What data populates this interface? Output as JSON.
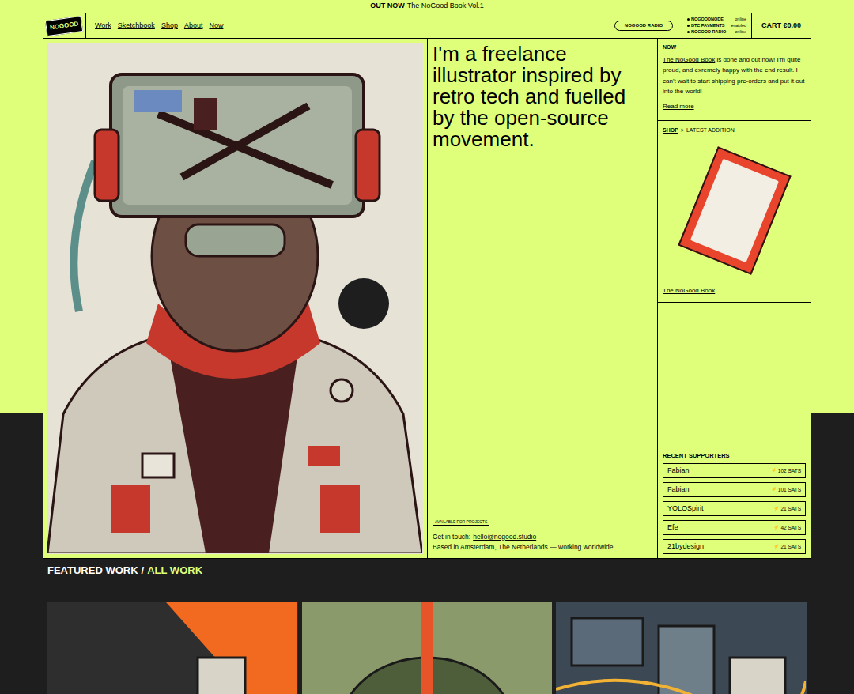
{
  "announcement": {
    "label": "OUT NOW",
    "text": "The NoGood Book Vol.1"
  },
  "nav": {
    "logo": "NOGOOD",
    "links": [
      "Work",
      "Sketchbook",
      "Shop",
      "About",
      "Now"
    ],
    "radio_button": "NOGOOD RADIO",
    "status": [
      {
        "name": "NOGOODNODE",
        "state": "online"
      },
      {
        "name": "BTC PAYMENTS",
        "state": "enabled"
      },
      {
        "name": "NOGOOD RADIO",
        "state": "online"
      }
    ],
    "cart": "CART €0.00"
  },
  "hero": {
    "headline": "I'm a freelance illustrator inspired by retro tech and fuelled by the open-source movement.",
    "badge": "AVAILABLE FOR PROJECTS",
    "contact_label": "Get in touch:",
    "email": "hello@nogood.studio",
    "location": "Based in Amsterdam, The Netherlands — working worldwide."
  },
  "now": {
    "title": "NOW",
    "link": "The NoGood Book",
    "text": " is done and out now! I'm quite proud, and exremely happy with the end result. I can't wait to start shipping pre-orders and put it out into the world!",
    "read_more": "Read more"
  },
  "shop": {
    "link": "SHOP",
    "separator": ">",
    "title": "LATEST ADDITION",
    "product": "The NoGood Book"
  },
  "supporters": {
    "title": "RECENT SUPPORTERS",
    "items": [
      {
        "name": "Fabian",
        "icon": "⚡",
        "amount": "102 SATS"
      },
      {
        "name": "Fabian",
        "icon": "⚡",
        "amount": "101 SATS"
      },
      {
        "name": "YOLOSpirit",
        "icon": "⚡",
        "amount": "21 SATS"
      },
      {
        "name": "Efe",
        "icon": "⚡",
        "amount": "42 SATS"
      },
      {
        "name": "21bydesign",
        "icon": "⚡",
        "amount": "21 SATS"
      }
    ]
  },
  "featured": {
    "title": "FEATURED WORK",
    "separator": "/",
    "link": "ALL WORK"
  }
}
